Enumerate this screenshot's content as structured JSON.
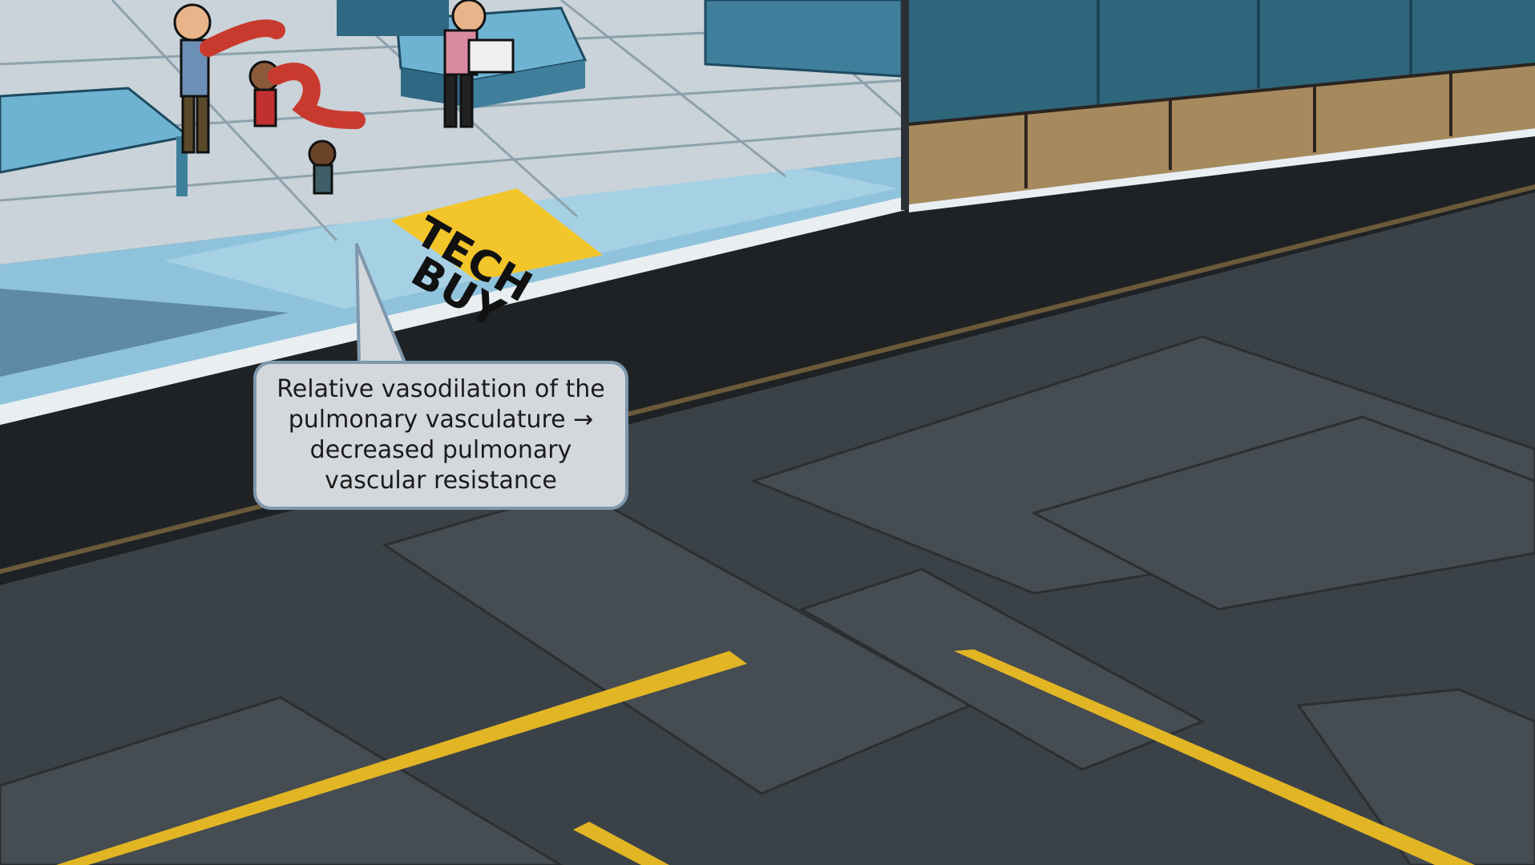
{
  "callout": {
    "text": "Relative vasodilation of the\npulmonary vasculature →\ndecreased pulmonary\nvascular resistance"
  },
  "store_sign": {
    "line1": "TECH",
    "line2": "BUY"
  },
  "colors": {
    "asphalt": "#3b4247",
    "road_dark": "#1f2225",
    "sidewalk": "#8fc3dc",
    "store_floor": "#c9d3d9",
    "lane_line": "#e2b524",
    "sign_yellow": "#f2c52a",
    "brick": "#a68a5d"
  }
}
